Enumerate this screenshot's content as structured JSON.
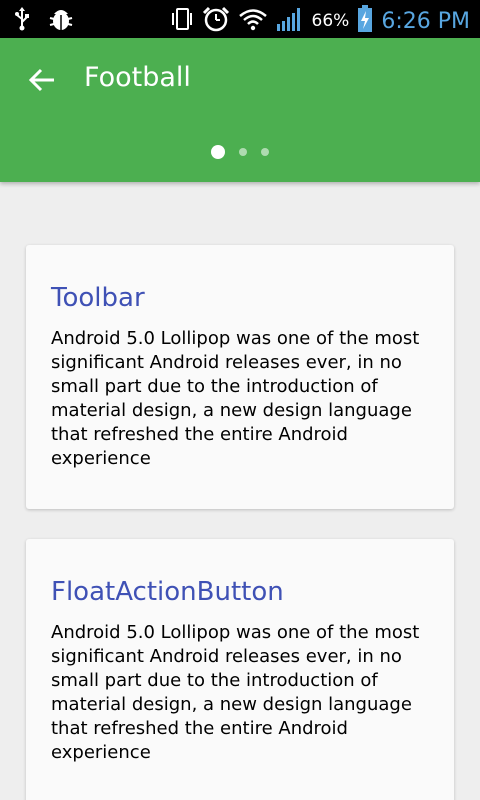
{
  "status_bar": {
    "battery_percent": "66%",
    "time": "6:26 PM",
    "icons": [
      "usb-icon",
      "debug-icon",
      "vibrate-icon",
      "alarm-icon",
      "wifi-icon",
      "signal-icon",
      "battery-charging-icon"
    ]
  },
  "app_bar": {
    "title": "Football",
    "pager": {
      "count": 3,
      "active_index": 0
    },
    "background_color": "#4caf50"
  },
  "cards": [
    {
      "title": "Toolbar",
      "body": "Android 5.0 Lollipop was one of the most significant Android releases ever, in no small part due to the introduction of material design, a new design language that refreshed the entire Android experience"
    },
    {
      "title": "FloatActionButton",
      "body": "Android 5.0 Lollipop was one of the most significant Android releases ever, in no small part due to the introduction of material design, a new design language that refreshed the entire Android experience"
    }
  ],
  "colors": {
    "card_title": "#3f51b5",
    "time_text": "#58a6e0",
    "page_background": "#eeeeee"
  }
}
